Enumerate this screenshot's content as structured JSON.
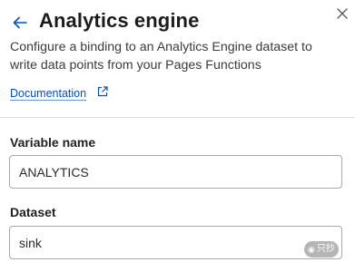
{
  "header": {
    "title": "Analytics engine",
    "description": "Configure a binding to an Analytics Engine dataset to write data points from your Pages Functions",
    "documentation_link": "Documentation",
    "icons": {
      "back": "arrow-left-icon",
      "close": "close-icon",
      "external": "external-link-icon"
    }
  },
  "form": {
    "variable_name": {
      "label": "Variable name",
      "value": "ANALYTICS"
    },
    "dataset": {
      "label": "Dataset",
      "value": "sink"
    }
  },
  "watermark": {
    "text": "只抄"
  },
  "colors": {
    "link": "#0051c3",
    "back_arrow": "#0051c3",
    "border": "#a9a9a9",
    "divider": "#dedede"
  }
}
